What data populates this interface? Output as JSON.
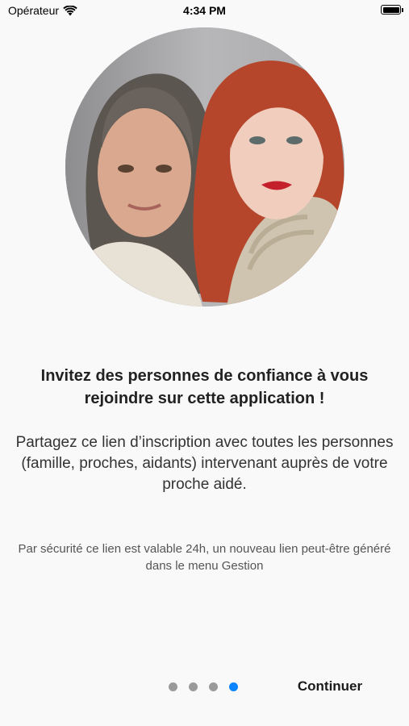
{
  "status_bar": {
    "carrier": "Opérateur",
    "time": "4:34 PM"
  },
  "hero_image": {
    "description": "two-women-portrait"
  },
  "title": "Invitez des personnes de confiance à vous rejoindre sur cette application !",
  "description": "Partagez ce lien d’inscription avec toutes les personnes (famille, proches, aidants) intervenant auprès de votre proche aidé.",
  "notice": "Par sécurité ce lien est valable 24h, un nouveau lien peut-être généré dans le menu Gestion",
  "pagination": {
    "total": 4,
    "current": 4
  },
  "continue_label": "Continuer",
  "colors": {
    "background": "#f9f9f9",
    "active_dot": "#0a84ff",
    "inactive_dot": "#9a9a9a"
  }
}
